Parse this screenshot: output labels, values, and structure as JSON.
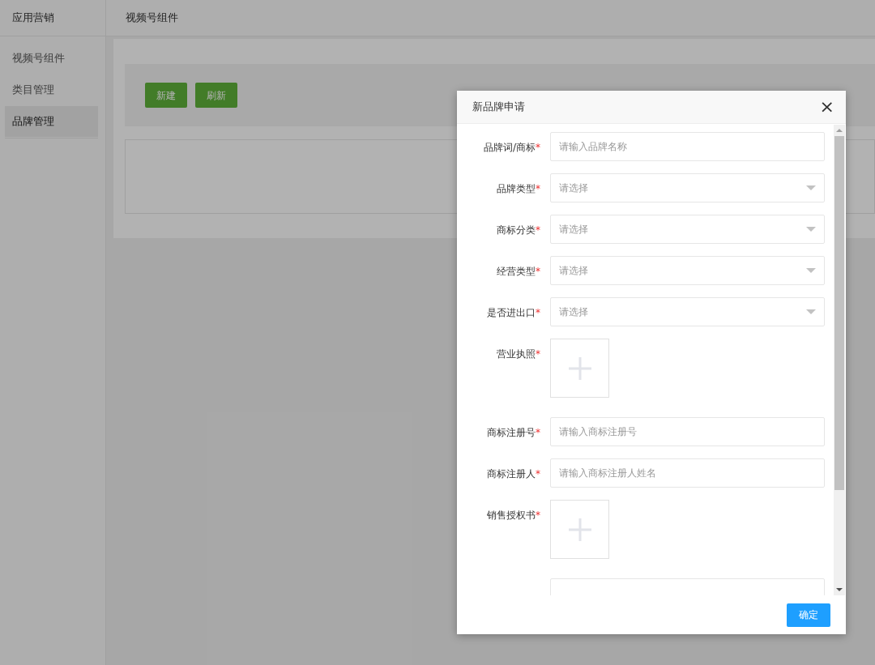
{
  "sidebar": {
    "title": "应用营销",
    "items": [
      {
        "label": "视频号组件",
        "selected": false
      },
      {
        "label": "类目管理",
        "selected": false
      },
      {
        "label": "品牌管理",
        "selected": true
      }
    ]
  },
  "header": {
    "title": "视频号组件"
  },
  "toolbar": {
    "buttons": [
      "新建",
      "刷新"
    ]
  },
  "dialog": {
    "title": "新品牌申请",
    "close": "×",
    "required_mark": "*",
    "fields": [
      {
        "kind": "input",
        "label": "品牌词/商标",
        "required": true,
        "placeholder": "请输入品牌名称"
      },
      {
        "kind": "select",
        "label": "品牌类型",
        "required": true,
        "placeholder": "请选择"
      },
      {
        "kind": "select",
        "label": "商标分类",
        "required": true,
        "placeholder": "请选择"
      },
      {
        "kind": "select",
        "label": "经营类型",
        "required": true,
        "placeholder": "请选择"
      },
      {
        "kind": "select",
        "label": "是否进出口",
        "required": true,
        "placeholder": "请选择"
      },
      {
        "kind": "upload",
        "label": "营业执照",
        "required": true
      },
      {
        "kind": "input",
        "label": "商标注册号",
        "required": true,
        "placeholder": "请输入商标注册号"
      },
      {
        "kind": "input",
        "label": "商标注册人",
        "required": true,
        "placeholder": "请输入商标注册人姓名"
      },
      {
        "kind": "upload",
        "label": "销售授权书",
        "required": true
      },
      {
        "kind": "input"
      }
    ],
    "confirm": "确定"
  }
}
